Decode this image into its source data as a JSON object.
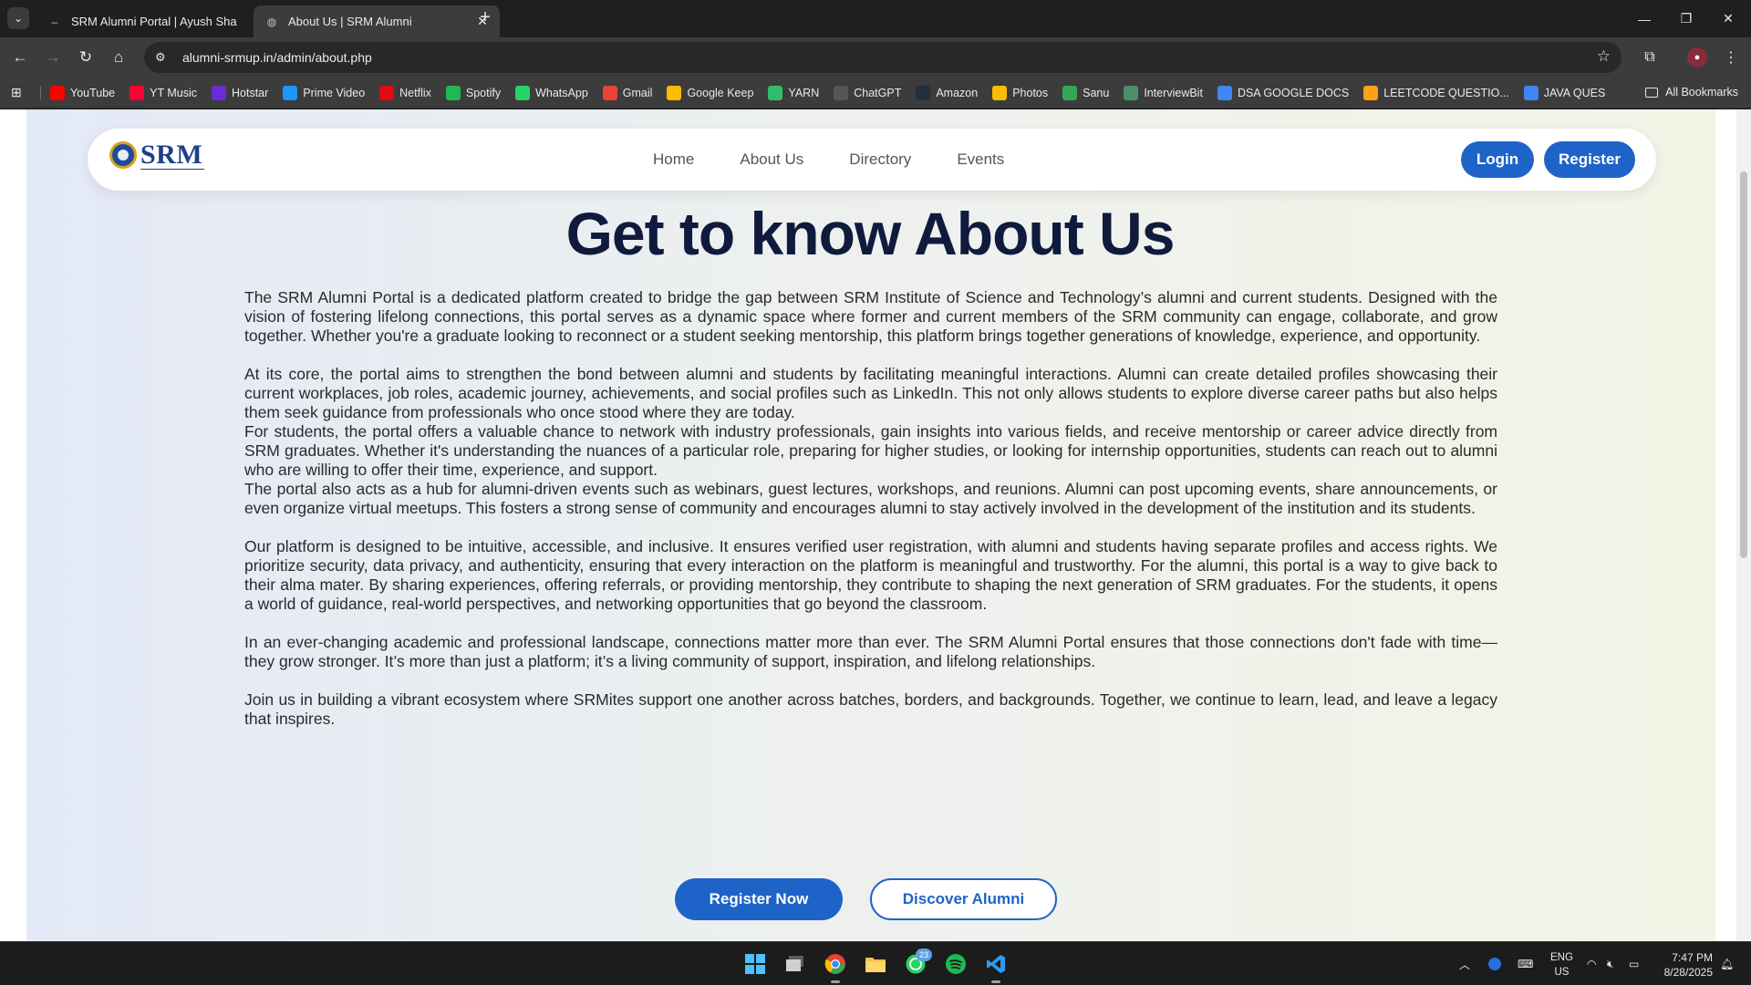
{
  "browser": {
    "tabs": [
      {
        "title": "SRM Alumni Portal | Ayush Sha",
        "active": false
      },
      {
        "title": "About Us | SRM Alumni",
        "active": true
      }
    ],
    "url": "alumni-srmup.in/admin/about.php",
    "bookmarks": [
      {
        "label": "YouTube",
        "color": "#ff0000",
        "icon": "youtube-icon"
      },
      {
        "label": "YT Music",
        "color": "#ff0033",
        "icon": "yt-music-icon"
      },
      {
        "label": "Hotstar",
        "color": "#6b2bd9",
        "icon": "hotstar-icon"
      },
      {
        "label": "Prime Video",
        "color": "#1a98ff",
        "icon": "prime-video-icon"
      },
      {
        "label": "Netflix",
        "color": "#e50914",
        "icon": "netflix-icon"
      },
      {
        "label": "Spotify",
        "color": "#1db954",
        "icon": "spotify-icon"
      },
      {
        "label": "WhatsApp",
        "color": "#25d366",
        "icon": "whatsapp-icon"
      },
      {
        "label": "Gmail",
        "color": "#ea4335",
        "icon": "gmail-icon"
      },
      {
        "label": "Google Keep",
        "color": "#fbbc04",
        "icon": "google-keep-icon"
      },
      {
        "label": "YARN",
        "color": "#2ebd6b",
        "icon": "yarn-icon"
      },
      {
        "label": "ChatGPT",
        "color": "#555555",
        "icon": "chatgpt-icon"
      },
      {
        "label": "Amazon",
        "color": "#232f3e",
        "icon": "amazon-icon"
      },
      {
        "label": "Photos",
        "color": "#fbbc04",
        "icon": "photos-icon"
      },
      {
        "label": "Sanu",
        "color": "#34a853",
        "icon": "sanu-icon"
      },
      {
        "label": "InterviewBit",
        "color": "#4a8f6a",
        "icon": "interviewbit-icon"
      },
      {
        "label": "DSA GOOGLE DOCS",
        "color": "#4285f4",
        "icon": "docs-icon"
      },
      {
        "label": "LEETCODE QUESTIO...",
        "color": "#ffa116",
        "icon": "leetcode-icon"
      },
      {
        "label": "JAVA QUES",
        "color": "#4285f4",
        "icon": "docs-icon"
      }
    ],
    "all_bookmarks": "All Bookmarks"
  },
  "site": {
    "logo_text": "SRM",
    "nav": [
      "Home",
      "About Us",
      "Directory",
      "Events"
    ],
    "login": "Login",
    "register": "Register",
    "heading": "Get to know About Us",
    "paragraphs": [
      "The SRM Alumni Portal is a dedicated platform created to bridge the gap between SRM Institute of Science and Technology’s alumni and current students. Designed with the vision of fostering lifelong connections, this portal serves as a dynamic space where former and current members of the SRM community can engage, collaborate, and grow together. Whether you're a graduate looking to reconnect or a student seeking mentorship, this platform brings together generations of knowledge, experience, and opportunity.",
      "At its core, the portal aims to strengthen the bond between alumni and students by facilitating meaningful interactions. Alumni can create detailed profiles showcasing their current workplaces, job roles, academic journey, achievements, and social profiles such as LinkedIn. This not only allows students to explore diverse career paths but also helps them seek guidance from professionals who once stood where they are today.",
      "For students, the portal offers a valuable chance to network with industry professionals, gain insights into various fields, and receive mentorship or career advice directly from SRM graduates. Whether it's understanding the nuances of a particular role, preparing for higher studies, or looking for internship opportunities, students can reach out to alumni who are willing to offer their time, experience, and support.",
      "The portal also acts as a hub for alumni-driven events such as webinars, guest lectures, workshops, and reunions. Alumni can post upcoming events, share announcements, or even organize virtual meetups. This fosters a strong sense of community and encourages alumni to stay actively involved in the development of the institution and its students.",
      "Our platform is designed to be intuitive, accessible, and inclusive. It ensures verified user registration, with alumni and students having separate profiles and access rights. We prioritize security, data privacy, and authenticity, ensuring that every interaction on the platform is meaningful and trustworthy. For the alumni, this portal is a way to give back to their alma mater. By sharing experiences, offering referrals, or providing mentorship, they contribute to shaping the next generation of SRM graduates. For the students, it opens a world of guidance, real-world perspectives, and networking opportunities that go beyond the classroom.",
      "In an ever-changing academic and professional landscape, connections matter more than ever. The SRM Alumni Portal ensures that those connections don't fade with time—they grow stronger. It’s more than just a platform; it’s a living community of support, inspiration, and lifelong relationships.",
      "Join us in building a vibrant ecosystem where SRMites support one another across batches, borders, and backgrounds. Together, we continue to learn, lead, and leave a legacy that inspires."
    ],
    "register_now": "Register Now",
    "discover_alumni": "Discover Alumni"
  },
  "taskbar": {
    "whatsapp_badge": "23",
    "lang_top": "ENG",
    "lang_bottom": "US",
    "time": "7:47 PM",
    "date": "8/28/2025"
  },
  "colors": {
    "accent": "#1e63c8",
    "heading": "#0f1a3d"
  }
}
